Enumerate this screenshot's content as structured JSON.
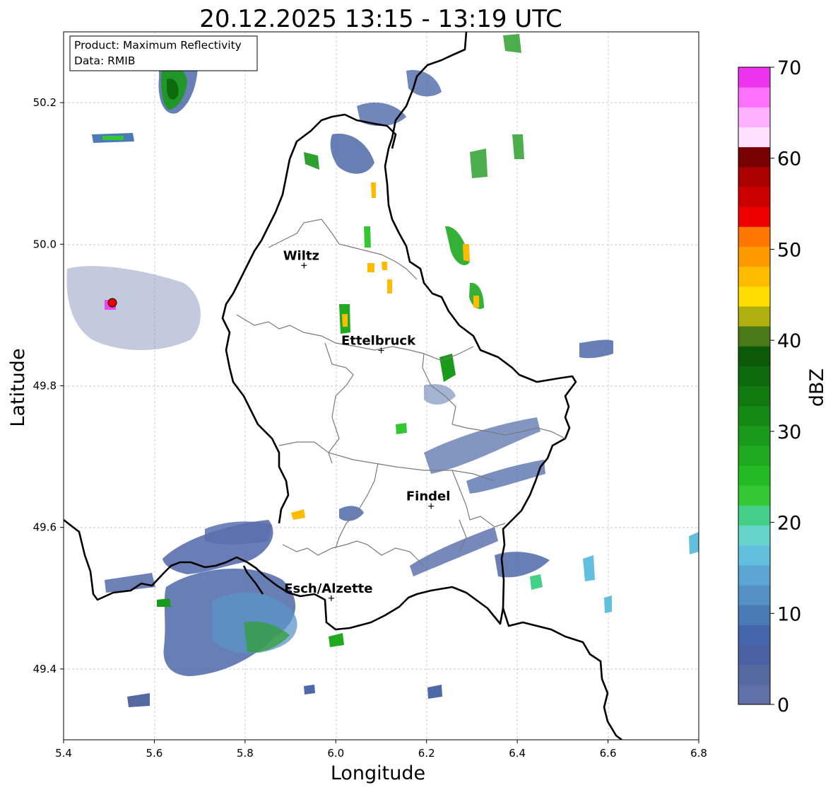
{
  "title": "20.12.2025 13:15 - 13:19 UTC",
  "info": {
    "product": "Product: Maximum Reflectivity",
    "data": "Data: RMIB"
  },
  "axes": {
    "xlabel": "Longitude",
    "ylabel": "Latitude",
    "xlim": [
      5.4,
      6.8
    ],
    "ylim": [
      49.3,
      50.3
    ],
    "xticks": [
      "5.4",
      "5.6",
      "5.8",
      "6.0",
      "6.2",
      "6.4",
      "6.6",
      "6.8"
    ],
    "yticks": [
      "49.4",
      "49.6",
      "49.8",
      "50.0",
      "50.2"
    ],
    "grid": true
  },
  "cities": [
    {
      "name": "Wiltz",
      "lon": 5.93,
      "lat": 49.97
    },
    {
      "name": "Ettelbruck",
      "lon": 6.1,
      "lat": 49.85
    },
    {
      "name": "Findel",
      "lon": 6.21,
      "lat": 49.63
    },
    {
      "name": "Esch/Alzette",
      "lon": 5.99,
      "lat": 49.5
    }
  ],
  "radar_site": {
    "lon": 5.505,
    "lat": 49.918
  },
  "colorbar": {
    "label": "dBZ",
    "ticks": [
      "0",
      "10",
      "20",
      "30",
      "40",
      "50",
      "60",
      "70"
    ],
    "min": 0,
    "max": 70,
    "colors": [
      "#6070a8",
      "#5568a0",
      "#4a62a4",
      "#4466aa",
      "#4a7ab5",
      "#5590c5",
      "#5ca6d4",
      "#62c0de",
      "#66d4c8",
      "#44d088",
      "#33c833",
      "#22bb22",
      "#1faa1f",
      "#1a9a1a",
      "#148a14",
      "#107a10",
      "#0d6a0d",
      "#0a5a0a",
      "#4a7a18",
      "#b0b010",
      "#ffdd00",
      "#ffbb00",
      "#ff9900",
      "#ff7700",
      "#ee0000",
      "#cc0000",
      "#aa0000",
      "#770000",
      "#ffe0ff",
      "#ffb0ff",
      "#ff70ff",
      "#ee33ee"
    ]
  }
}
